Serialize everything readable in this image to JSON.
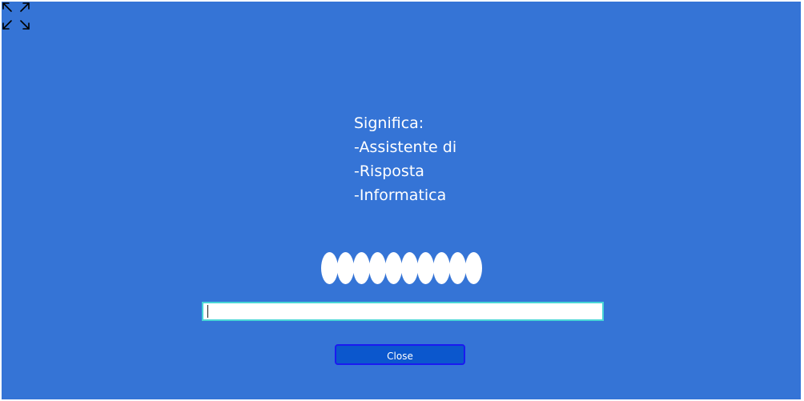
{
  "icons": {
    "fullscreen": "expand-arrows-icon"
  },
  "meaning": {
    "heading": "Significa:",
    "lines": [
      "-Assistente di",
      "-Risposta",
      "-Informatica"
    ]
  },
  "masked_word": {
    "hidden_letter_count": 10
  },
  "answer": {
    "value": "",
    "placeholder": ""
  },
  "actions": {
    "close_label": "Close"
  },
  "colors": {
    "background": "#3574d6",
    "input_border": "#49d6d6",
    "button_fill": "#0b57cd",
    "button_border": "#1a1af0",
    "text": "#ffffff"
  }
}
